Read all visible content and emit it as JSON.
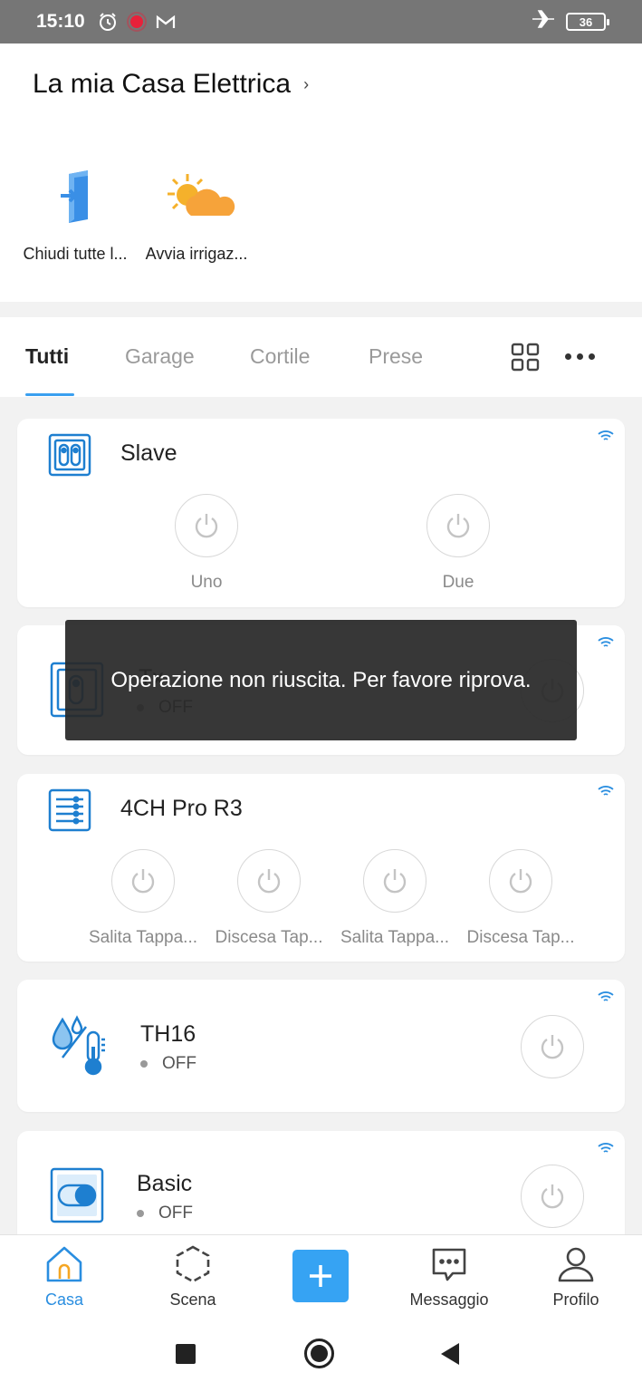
{
  "status_bar": {
    "time": "15:10",
    "battery": "36"
  },
  "home": {
    "title": "La mia Casa Elettrica",
    "chevron": "›"
  },
  "scenes": [
    {
      "label": "Chiudi tutte l...",
      "icon": "door-enter-icon"
    },
    {
      "label": "Avvia irrigaz...",
      "icon": "sun-cloud-icon"
    }
  ],
  "tabs": [
    "Tutti",
    "Garage",
    "Cortile",
    "Prese"
  ],
  "devices": [
    {
      "name": "Slave",
      "icon": "dual-switch-icon",
      "channels": [
        "Uno",
        "Due"
      ]
    },
    {
      "name": "Tx",
      "state": "OFF",
      "icon": "single-switch-icon"
    },
    {
      "name": "4CH Pro R3",
      "icon": "four-channel-icon",
      "channels": [
        "Salita Tappa...",
        "Discesa Tap...",
        "Salita Tappa...",
        "Discesa Tap..."
      ]
    },
    {
      "name": "TH16",
      "state": "OFF",
      "icon": "temperature-humidity-icon"
    },
    {
      "name": "Basic",
      "state": "OFF",
      "icon": "toggle-switch-icon"
    }
  ],
  "toast": {
    "message": "Operazione non riuscita. Per favore riprova."
  },
  "bottom_nav": {
    "casa": "Casa",
    "scena": "Scena",
    "messaggio": "Messaggio",
    "profilo": "Profilo"
  },
  "colors": {
    "accent": "#36a3f3",
    "device_blue": "#1e7fd0"
  }
}
